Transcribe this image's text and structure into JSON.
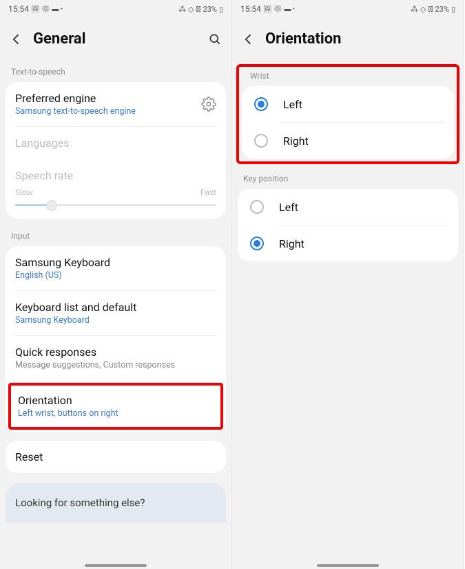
{
  "status": {
    "time": "15:54",
    "battery": "23%",
    "left_icons": "🖼 ⚙ 💬 •",
    "right_icons": "✱ ⩕ ⫶ "
  },
  "left": {
    "title": "General",
    "tts_header": "Text-to-speech",
    "pref_engine": {
      "title": "Preferred engine",
      "sub": "Samsung text-to-speech engine"
    },
    "languages": "Languages",
    "speech_rate": "Speech rate",
    "slow": "Slow",
    "fast": "Fast",
    "input_header": "Input",
    "keyboard": {
      "title": "Samsung Keyboard",
      "sub": "English (US)"
    },
    "kb_list": {
      "title": "Keyboard list and default",
      "sub": "Samsung Keyboard"
    },
    "quick": {
      "title": "Quick responses",
      "sub": "Message suggestions, Custom responses"
    },
    "orientation": {
      "title": "Orientation",
      "sub": "Left wrist, buttons on right"
    },
    "reset": "Reset",
    "footer": "Looking for something else?"
  },
  "right": {
    "title": "Orientation",
    "wrist_header": "Wrist",
    "left_opt": "Left",
    "right_opt": "Right",
    "keypos_header": "Key position"
  }
}
